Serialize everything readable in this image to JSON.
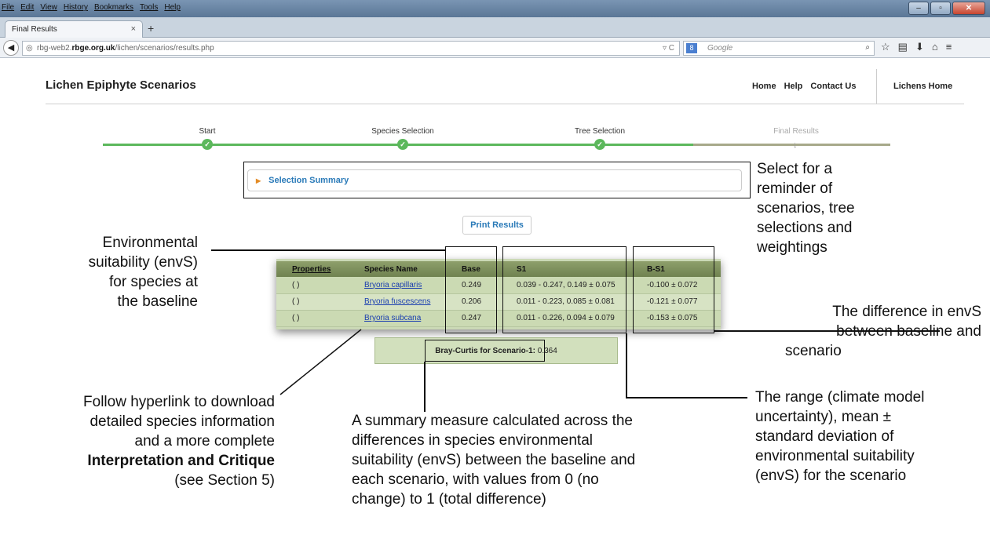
{
  "browser": {
    "menu": [
      "File",
      "Edit",
      "View",
      "History",
      "Bookmarks",
      "Tools",
      "Help"
    ],
    "tab_title": "Final Results",
    "tab_close": "×",
    "new_tab": "+",
    "url_prefix": "rbg-web2.",
    "url_domain": "rbge.org.uk",
    "url_path": "/lichen/scenarios/results.php",
    "search_placeholder": "Google",
    "search_engine_badge": "8"
  },
  "site": {
    "title": "Lichen Epiphyte Scenarios",
    "nav": [
      "Home",
      "Help",
      "Contact Us"
    ],
    "lichens_home": "Lichens Home"
  },
  "steps": [
    {
      "label": "Start",
      "done": true
    },
    {
      "label": "Species Selection",
      "done": true
    },
    {
      "label": "Tree Selection",
      "done": true
    },
    {
      "label": "Final Results",
      "done": false
    }
  ],
  "summary": {
    "label": "Selection Summary"
  },
  "print_button": "Print Results",
  "table": {
    "headers": [
      "Properties",
      "Species Name",
      "Base",
      "S1",
      "B-S1"
    ],
    "rows": [
      {
        "properties": "( )",
        "species": "Bryoria capillaris",
        "base": "0.249",
        "s1": "0.039 - 0.247, 0.149 ± 0.075",
        "bs1": "-0.100 ± 0.072"
      },
      {
        "properties": "( )",
        "species": "Bryoria fuscescens",
        "base": "0.206",
        "s1": "0.011 - 0.223, 0.085 ± 0.081",
        "bs1": "-0.121 ± 0.077"
      },
      {
        "properties": "( )",
        "species": "Bryoria subcana",
        "base": "0.247",
        "s1": "0.011 - 0.226, 0.094 ± 0.079",
        "bs1": "-0.153 ± 0.075"
      }
    ]
  },
  "bray": {
    "label": "Bray-Curtis for Scenario-1:",
    "value": "0.364"
  },
  "annotations": {
    "env_base": [
      "Environmental",
      "suitability (envS)",
      "for species at",
      "the baseline"
    ],
    "select_reminder": [
      "Select for a",
      "reminder of",
      "scenarios, tree",
      "selections and",
      "weightings"
    ],
    "difference": [
      "The difference in envS",
      "between baseline and",
      "scenario"
    ],
    "hyperlink": [
      "Follow hyperlink to download",
      "detailed species information",
      "and a more complete"
    ],
    "hyperlink_bold": "Interpretation and Critique",
    "hyperlink_see": "(see Section 5)",
    "summary_measure": [
      "A summary measure calculated across the",
      "differences in species environmental",
      "suitability (envS) between the baseline and",
      "each scenario, with values from 0 (no",
      "change) to 1 (total difference)"
    ],
    "range": [
      "The range (climate model",
      "uncertainty), mean ±",
      "standard deviation of",
      "environmental suitability",
      "(envS) for the scenario"
    ]
  },
  "colors": {
    "accent": "#2a7ab8",
    "step_done": "#5cb85c",
    "step_pending": "#a7a98a",
    "table_header": "#7d8f5c",
    "table_body": "#cbdab3"
  }
}
